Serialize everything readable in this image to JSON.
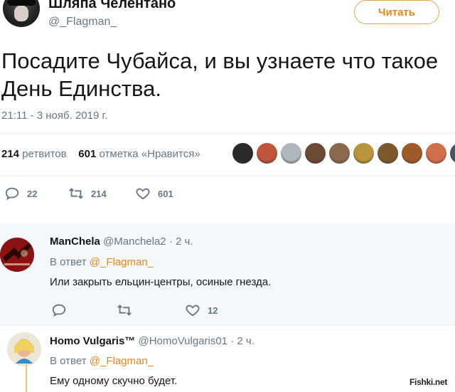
{
  "tweet": {
    "author_name": "Шляпа Челентано",
    "author_handle": "@_Flagman_",
    "follow_label": "Читать",
    "text_line1": "Посадите Чубайса, и вы узнаете что такое",
    "text_line2": "День Единства.",
    "timestamp": "21:11 - 3 нояб. 2019 г.",
    "retweets_count": "214",
    "retweets_label": "ретвитов",
    "likes_count": "601",
    "likes_label": "отметка «Нравится»",
    "liker_colors": [
      "#2a2a2a",
      "#c0543c",
      "#b0b7bf",
      "#6b4b34",
      "#8a6a4e",
      "#b8943c",
      "#7d5a2d",
      "#a05a2a",
      "#d0704a",
      "#4a5560"
    ],
    "actions": {
      "reply_count": "22",
      "retweet_count": "214",
      "like_count": "601"
    }
  },
  "replies": [
    {
      "name": "ManChela",
      "handle": "@Manchela2",
      "time": "· 2 ч.",
      "in_reply_prefix": "В ответ",
      "in_reply_to": "@_Flagman_",
      "text": "Или закрыть ельцин-центры, осиные гнезда.",
      "like_count": "12"
    },
    {
      "name": "Homo Vulgaris™",
      "handle": "@HomoVulgaris01",
      "time": "· 2 ч.",
      "in_reply_prefix": "В ответ",
      "in_reply_to": "@_Flagman_",
      "text": "Ему одному скучно будет."
    }
  ],
  "watermark": "Fishki.net",
  "colors": {
    "accent": "#e8861e",
    "secondary_text": "#657786",
    "reply_bg": "#f5f8fa"
  }
}
